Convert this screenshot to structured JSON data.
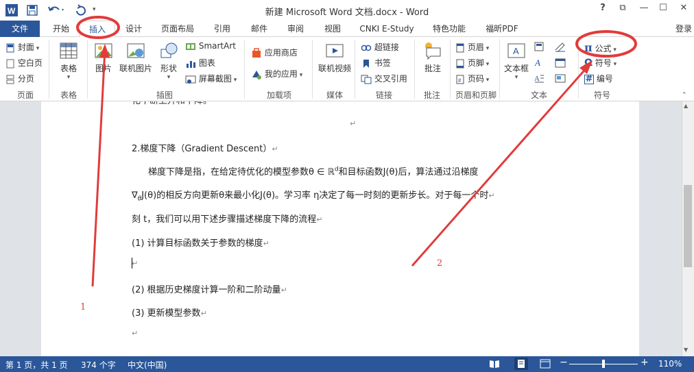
{
  "titlebar": {
    "title": "新建 Microsoft Word 文档.docx - Word",
    "help": "?",
    "restore_box": "⧉",
    "minimize": "—",
    "maximize": "☐",
    "close": "✕"
  },
  "tabs": {
    "file": "文件",
    "home": "开始",
    "insert": "插入",
    "design": "设计",
    "layout": "页面布局",
    "references": "引用",
    "mailings": "邮件",
    "review": "审阅",
    "view": "视图",
    "cnki": "CNKI E-Study",
    "special": "特色功能",
    "foxit": "福昕PDF",
    "login": "登录"
  },
  "ribbon": {
    "pages": {
      "cover": "封面",
      "blank": "空白页",
      "break": "分页",
      "group": "页面"
    },
    "tables": {
      "table": "表格",
      "group": "表格"
    },
    "illustrations": {
      "picture": "图片",
      "online_picture": "联机图片",
      "shapes": "形状",
      "smartart": "SmartArt",
      "chart": "图表",
      "screenshot": "屏幕截图",
      "group": "插图"
    },
    "addins": {
      "store": "应用商店",
      "myapps": "我的应用",
      "group": "加载项"
    },
    "media": {
      "online_video": "联机视频",
      "group": "媒体"
    },
    "links": {
      "hyperlink": "超链接",
      "bookmark": "书签",
      "crossref": "交叉引用",
      "group": "链接"
    },
    "comments": {
      "comment": "批注",
      "group": "批注"
    },
    "header_footer": {
      "header": "页眉",
      "footer": "页脚",
      "page_number": "页码",
      "group": "页眉和页脚"
    },
    "text": {
      "textbox": "文本框",
      "group": "文本"
    },
    "symbols": {
      "equation": "公式",
      "symbol": "符号",
      "number": "编号",
      "group": "符号",
      "pi": "π",
      "omega": "Ω",
      "hash": "#"
    }
  },
  "document": {
    "line0": "化不断上升和下降。",
    "heading": "2.梯度下降（Gradient Descent）",
    "p1_a": "梯度下降是指，在给定待优化的模型参数θ ∈ ℝ",
    "p1_sup": "d",
    "p1_b": "和目标函数J(θ)后，算法通过沿梯度",
    "p2_a": "∇",
    "p2_sub": "θ",
    "p2_b": "J(θ)的相反方向更新θ来最小化J(θ)。学习率 η决定了每一时刻的更新步长。对于每一个时",
    "p3": "刻 t，我们可以用下述步骤描述梯度下降的流程",
    "item1": "(1)  计算目标函数关于参数的梯度",
    "item2": "(2)  根据历史梯度计算一阶和二阶动量",
    "item3": "(3)  更新模型参数",
    "para_mark": "↵"
  },
  "annotations": {
    "one": "1",
    "two": "2",
    "color": "#e23b3b"
  },
  "statusbar": {
    "page": "第 1 页，共 1 页",
    "words": "374 个字",
    "lang": "中文(中国)",
    "zoom": "110%",
    "zoom_minus": "−",
    "zoom_plus": "+",
    "zoom_level": 0.5
  },
  "colors": {
    "accent": "#2b579a",
    "highlight": "#e23b3b"
  }
}
